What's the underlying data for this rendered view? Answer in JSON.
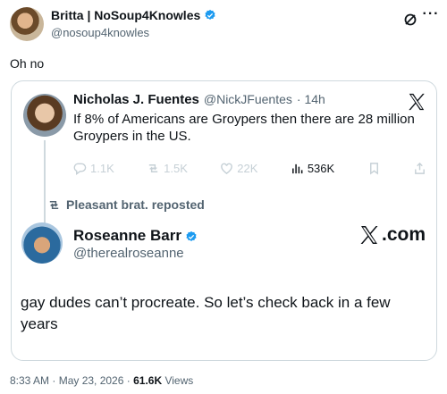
{
  "tweet": {
    "author_name": "Britta | NoSoup4Knowles",
    "author_handle": "@nosoup4knowles",
    "text": "Oh no",
    "timestamp": "8:33 AM · May 23, 2026",
    "views_count": "61.6K",
    "views_label": "Views",
    "separator": "·",
    "more_label": "···"
  },
  "quote": {
    "original": {
      "author_name": "Nicholas J. Fuentes",
      "author_handle": "@NickJFuentes",
      "time": "· 14h",
      "text": "If 8% of Americans are Groypers then there are 28 million Groypers in the US.",
      "stats": {
        "replies": "1.1K",
        "reposts": "1.5K",
        "likes": "22K",
        "views": "536K"
      }
    },
    "repost_label": "Pleasant brat. reposted",
    "reposted": {
      "author_name": "Roseanne Barr",
      "author_handle": "@therealroseanne",
      "text": "gay dudes can’t procreate. So let’s check back in a few years",
      "logo_text": ".com"
    }
  },
  "colors": {
    "verified_blue": "#1d9bf0",
    "secondary_text": "#536471",
    "border": "#cfd9de"
  }
}
